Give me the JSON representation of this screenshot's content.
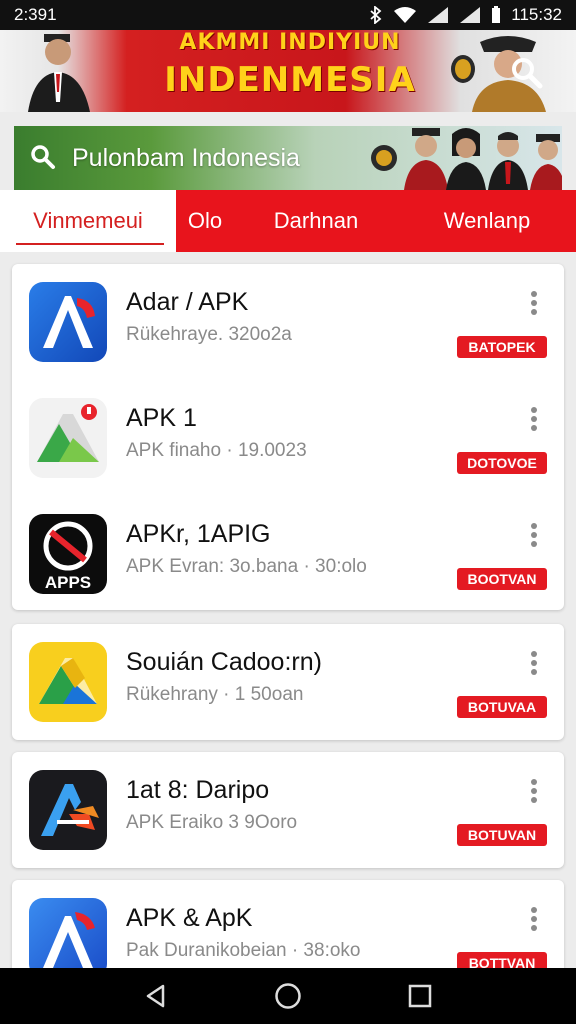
{
  "status_bar": {
    "time": "2:391",
    "clock": "115:32",
    "icons": [
      "bluetooth-icon",
      "wifi-icon",
      "signal-icon",
      "signal-icon",
      "battery-icon"
    ]
  },
  "banner": {
    "line1": "AKMMI INDIYIUN",
    "line2": "INDENMESIA",
    "search_icon": "search-icon"
  },
  "search": {
    "text": "Pulonbam Indonesia",
    "icon": "search-icon"
  },
  "tabs": [
    {
      "label": "Vinmemeui",
      "active": true
    },
    {
      "label": "Olo",
      "active": false
    },
    {
      "label": "Darhnan",
      "active": false
    },
    {
      "label": "Wenlanp",
      "active": false
    }
  ],
  "apps": [
    {
      "name": "Adar / APK",
      "sub": "Rükehraye. 320o2a",
      "button": "BATOPEK"
    },
    {
      "name": "APK 1",
      "sub": "APK finaho · 19.0023",
      "button": "DOTOVOE"
    },
    {
      "name": "APKr, 1APIG",
      "sub": "APK Evran: 3o.bana · 30:olo",
      "button": "BOOTVAN"
    },
    {
      "name": "Souián Cadoo:rn)",
      "sub": "Rükehrany · 1 50oan",
      "button": "BOTUVAA"
    },
    {
      "name": "1at 8: Daripo",
      "sub": "APK Eraiko 3 9Ooro",
      "button": "BOTUVAN"
    },
    {
      "name": "APK & ApK",
      "sub": "Pak Duranikobeian · 38:oko",
      "button": "BOTTVAN"
    }
  ],
  "colors": {
    "accent_red": "#e8141c",
    "button_red": "#e41a22",
    "banner_gold": "#ffd21a",
    "search_green": "#3a7d2e"
  },
  "nav": {
    "back": "back-icon",
    "home": "home-icon",
    "recents": "recents-icon"
  }
}
